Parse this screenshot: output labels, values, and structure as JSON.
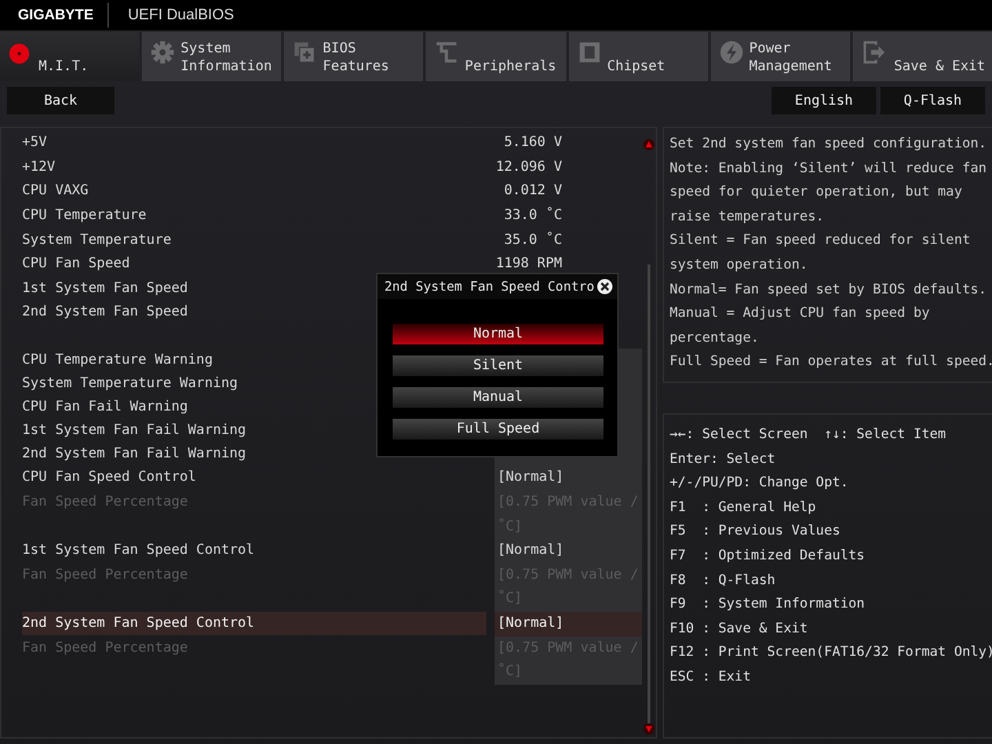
{
  "header": {
    "brand": "GIGABYTE",
    "title": "UEFI DualBIOS"
  },
  "tabs": [
    {
      "label": "M.I.T.",
      "selected": true
    },
    {
      "label": "System\nInformation",
      "selected": false
    },
    {
      "label": "BIOS\nFeatures",
      "selected": false
    },
    {
      "label": "Peripherals",
      "selected": false
    },
    {
      "label": "Chipset",
      "selected": false
    },
    {
      "label": "Power\nManagement",
      "selected": false
    },
    {
      "label": "Save & Exit",
      "selected": false
    }
  ],
  "toolbar": {
    "back": "Back",
    "buttons": [
      "English",
      "Q-Flash"
    ]
  },
  "rows": [
    {
      "kind": "reading",
      "label": "+5V",
      "value": "5.160 V"
    },
    {
      "kind": "reading",
      "label": "+12V",
      "value": "12.096 V"
    },
    {
      "kind": "reading",
      "label": "CPU VAXG",
      "value": "0.012 V"
    },
    {
      "kind": "reading",
      "label": "CPU Temperature",
      "value": "33.0 ˚C"
    },
    {
      "kind": "reading",
      "label": "System Temperature",
      "value": "35.0 ˚C"
    },
    {
      "kind": "reading",
      "label": "CPU Fan Speed",
      "value": "1198 RPM"
    },
    {
      "kind": "reading",
      "label": "1st System Fan Speed"
    },
    {
      "kind": "reading",
      "label": "2nd System Fan Speed"
    },
    {
      "kind": "gap"
    },
    {
      "kind": "setting",
      "label": "CPU Temperature Warning",
      "disabled": false,
      "selected": false
    },
    {
      "kind": "setting",
      "label": "System Temperature Warning",
      "disabled": false,
      "selected": false
    },
    {
      "kind": "setting",
      "label": "CPU Fan Fail Warning",
      "disabled": false,
      "selected": false
    },
    {
      "kind": "setting",
      "label": "1st System Fan Fail Warning",
      "disabled": false,
      "selected": false
    },
    {
      "kind": "setting",
      "label": "2nd System Fan Fail Warning",
      "disabled": false,
      "selected": false
    },
    {
      "kind": "setting",
      "label": "CPU Fan Speed Control",
      "value": "[Normal]",
      "disabled": false,
      "selected": false
    },
    {
      "kind": "setting",
      "label": "Fan Speed Percentage",
      "value": "[0.75 PWM value /˚C]",
      "disabled": true,
      "selected": false
    },
    {
      "kind": "setting",
      "label": "1st System Fan Speed Control",
      "value": "[Normal]",
      "disabled": false,
      "selected": false
    },
    {
      "kind": "setting",
      "label": "Fan Speed Percentage",
      "value": "[0.75 PWM value /˚C]",
      "disabled": true,
      "selected": false
    },
    {
      "kind": "setting",
      "label": "2nd System Fan Speed Control",
      "value": "[Normal]",
      "disabled": false,
      "selected": true
    },
    {
      "kind": "setting",
      "label": "Fan Speed Percentage",
      "value": "[0.75 PWM value /˚C]",
      "disabled": true,
      "selected": false
    }
  ],
  "popup": {
    "title": "2nd System Fan Speed Contro",
    "options": [
      {
        "label": "Normal",
        "selected": true
      },
      {
        "label": "Silent",
        "selected": false
      },
      {
        "label": "Manual",
        "selected": false
      },
      {
        "label": "Full Speed",
        "selected": false
      }
    ]
  },
  "help": [
    "Set 2nd system fan speed configuration.",
    "Note: Enabling ‘Silent’ will reduce fan speed for quieter operation, but may raise temperatures.",
    "Silent = Fan speed reduced for silent system operation.",
    "Normal= Fan speed set by BIOS defaults.",
    "Manual = Adjust CPU fan speed by percentage.",
    "Full Speed = Fan operates at full speed."
  ],
  "keys": [
    "→←: Select Screen  ↑↓: Select Item",
    "Enter: Select",
    "+/-/PU/PD: Change Opt.",
    "F1  : General Help",
    "F5  : Previous Values",
    "F7  : Optimized Defaults",
    "F8  : Q-Flash",
    "F9  : System Information",
    "F10 : Save & Exit",
    "F12 : Print Screen(FAT16/32 Format Only)",
    "ESC : Exit"
  ]
}
